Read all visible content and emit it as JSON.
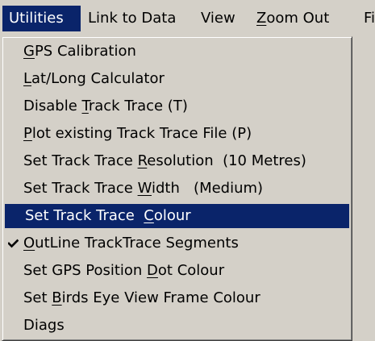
{
  "menubar": {
    "items": [
      {
        "pre": "Utilities",
        "key": "",
        "post": "",
        "active": true
      },
      {
        "pre": "Link to Data",
        "key": "",
        "post": "",
        "active": false
      },
      {
        "pre": "View",
        "key": "",
        "post": "",
        "active": false
      },
      {
        "pre": "",
        "key": "Z",
        "post": "oom Out",
        "active": false
      },
      {
        "pre": "Fi",
        "key": "",
        "post": "",
        "active": false
      }
    ]
  },
  "menu": {
    "items": [
      {
        "pre": "",
        "key": "G",
        "post": "PS Calibration"
      },
      {
        "pre": "",
        "key": "L",
        "post": "at/Long Calculator"
      },
      {
        "pre": "Disable ",
        "key": "T",
        "post": "rack Trace (T)"
      },
      {
        "pre": "",
        "key": "P",
        "post": "lot existing Track Trace File (P)"
      },
      {
        "pre": "Set Track Trace ",
        "key": "R",
        "post": "esolution  (10 Metres)"
      },
      {
        "pre": "Set Track Trace ",
        "key": "W",
        "post": "idth   (Medium)"
      },
      {
        "pre": "Set Track Trace  ",
        "key": "C",
        "post": "olour"
      },
      {
        "pre": "",
        "key": "O",
        "post": "utLine TrackTrace Segments"
      },
      {
        "pre": "Set GPS Position ",
        "key": "D",
        "post": "ot Colour"
      },
      {
        "pre": "Set ",
        "key": "B",
        "post": "irds Eye View Frame Colour"
      },
      {
        "pre": "Diags",
        "key": "",
        "post": ""
      }
    ],
    "highlighted_index": 6,
    "checked_index": 7
  },
  "colors": {
    "menu_bg": "#d4d0c8",
    "highlight_bg": "#0a246a",
    "highlight_text": "#ffffff",
    "text": "#000000"
  },
  "icons": {
    "checkmark": "checkmark-icon"
  }
}
